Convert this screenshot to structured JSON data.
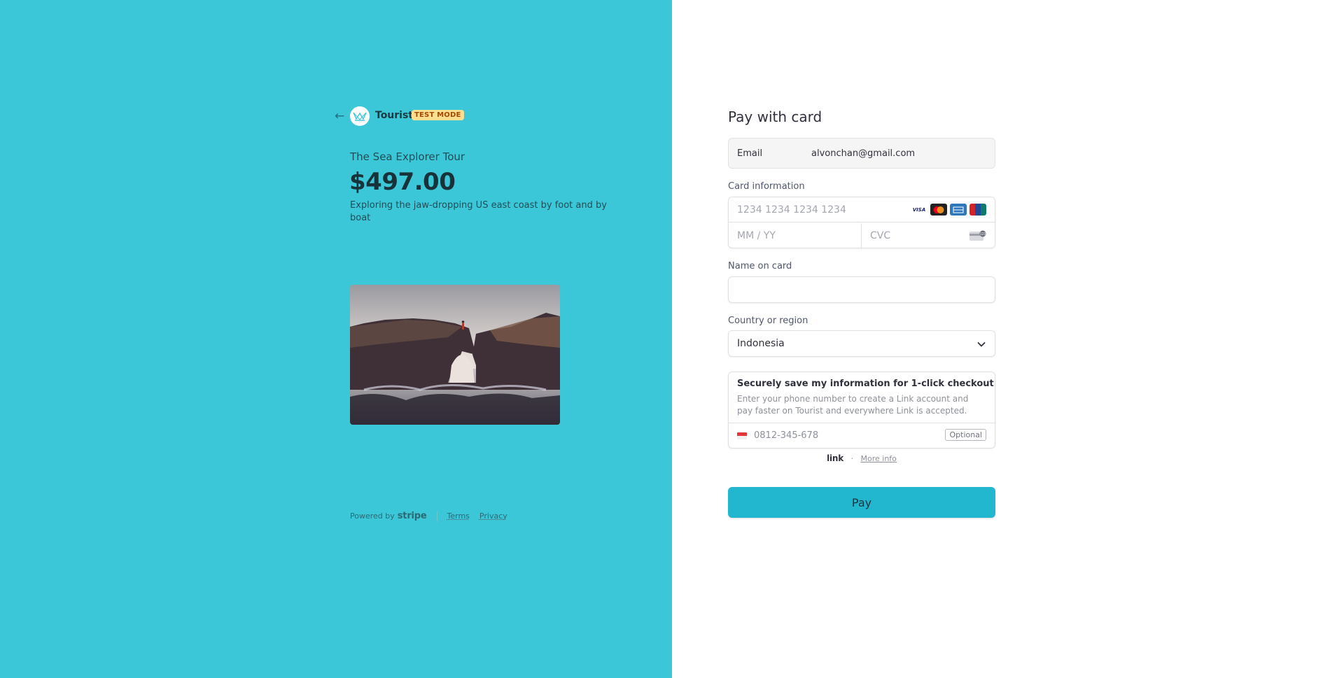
{
  "merchant": {
    "name": "Tourist",
    "test_badge": "TEST MODE"
  },
  "product": {
    "name": "The Sea Explorer Tour",
    "price": "$497.00",
    "description": "Exploring the jaw-dropping US east coast by foot and by boat"
  },
  "footer": {
    "powered_by": "Powered by",
    "stripe": "stripe",
    "terms": "Terms",
    "privacy": "Privacy"
  },
  "form": {
    "title": "Pay with card",
    "email_label": "Email",
    "email_value": "alvonchan@gmail.com",
    "card_label": "Card information",
    "card_placeholder": "1234 1234 1234 1234",
    "exp_placeholder": "MM / YY",
    "cvc_placeholder": "CVC",
    "brands": [
      "VISA",
      "mastercard",
      "amex",
      "unionpay"
    ],
    "name_label": "Name on card",
    "name_value": "",
    "country_label": "Country or region",
    "country_value": "Indonesia",
    "link": {
      "title": "Securely save my information for 1-click checkout",
      "subtitle": "Enter your phone number to create a Link account and pay faster on Tourist and everywhere Link is accepted.",
      "phone_placeholder": "0812-345-678",
      "optional": "Optional",
      "logo": "link",
      "separator": "·",
      "more_info": "More info"
    },
    "pay_label": "Pay"
  },
  "colors": {
    "left_bg": "#3cc7d9",
    "pay_button": "#22b6cf",
    "badge_bg": "#ffde92"
  }
}
